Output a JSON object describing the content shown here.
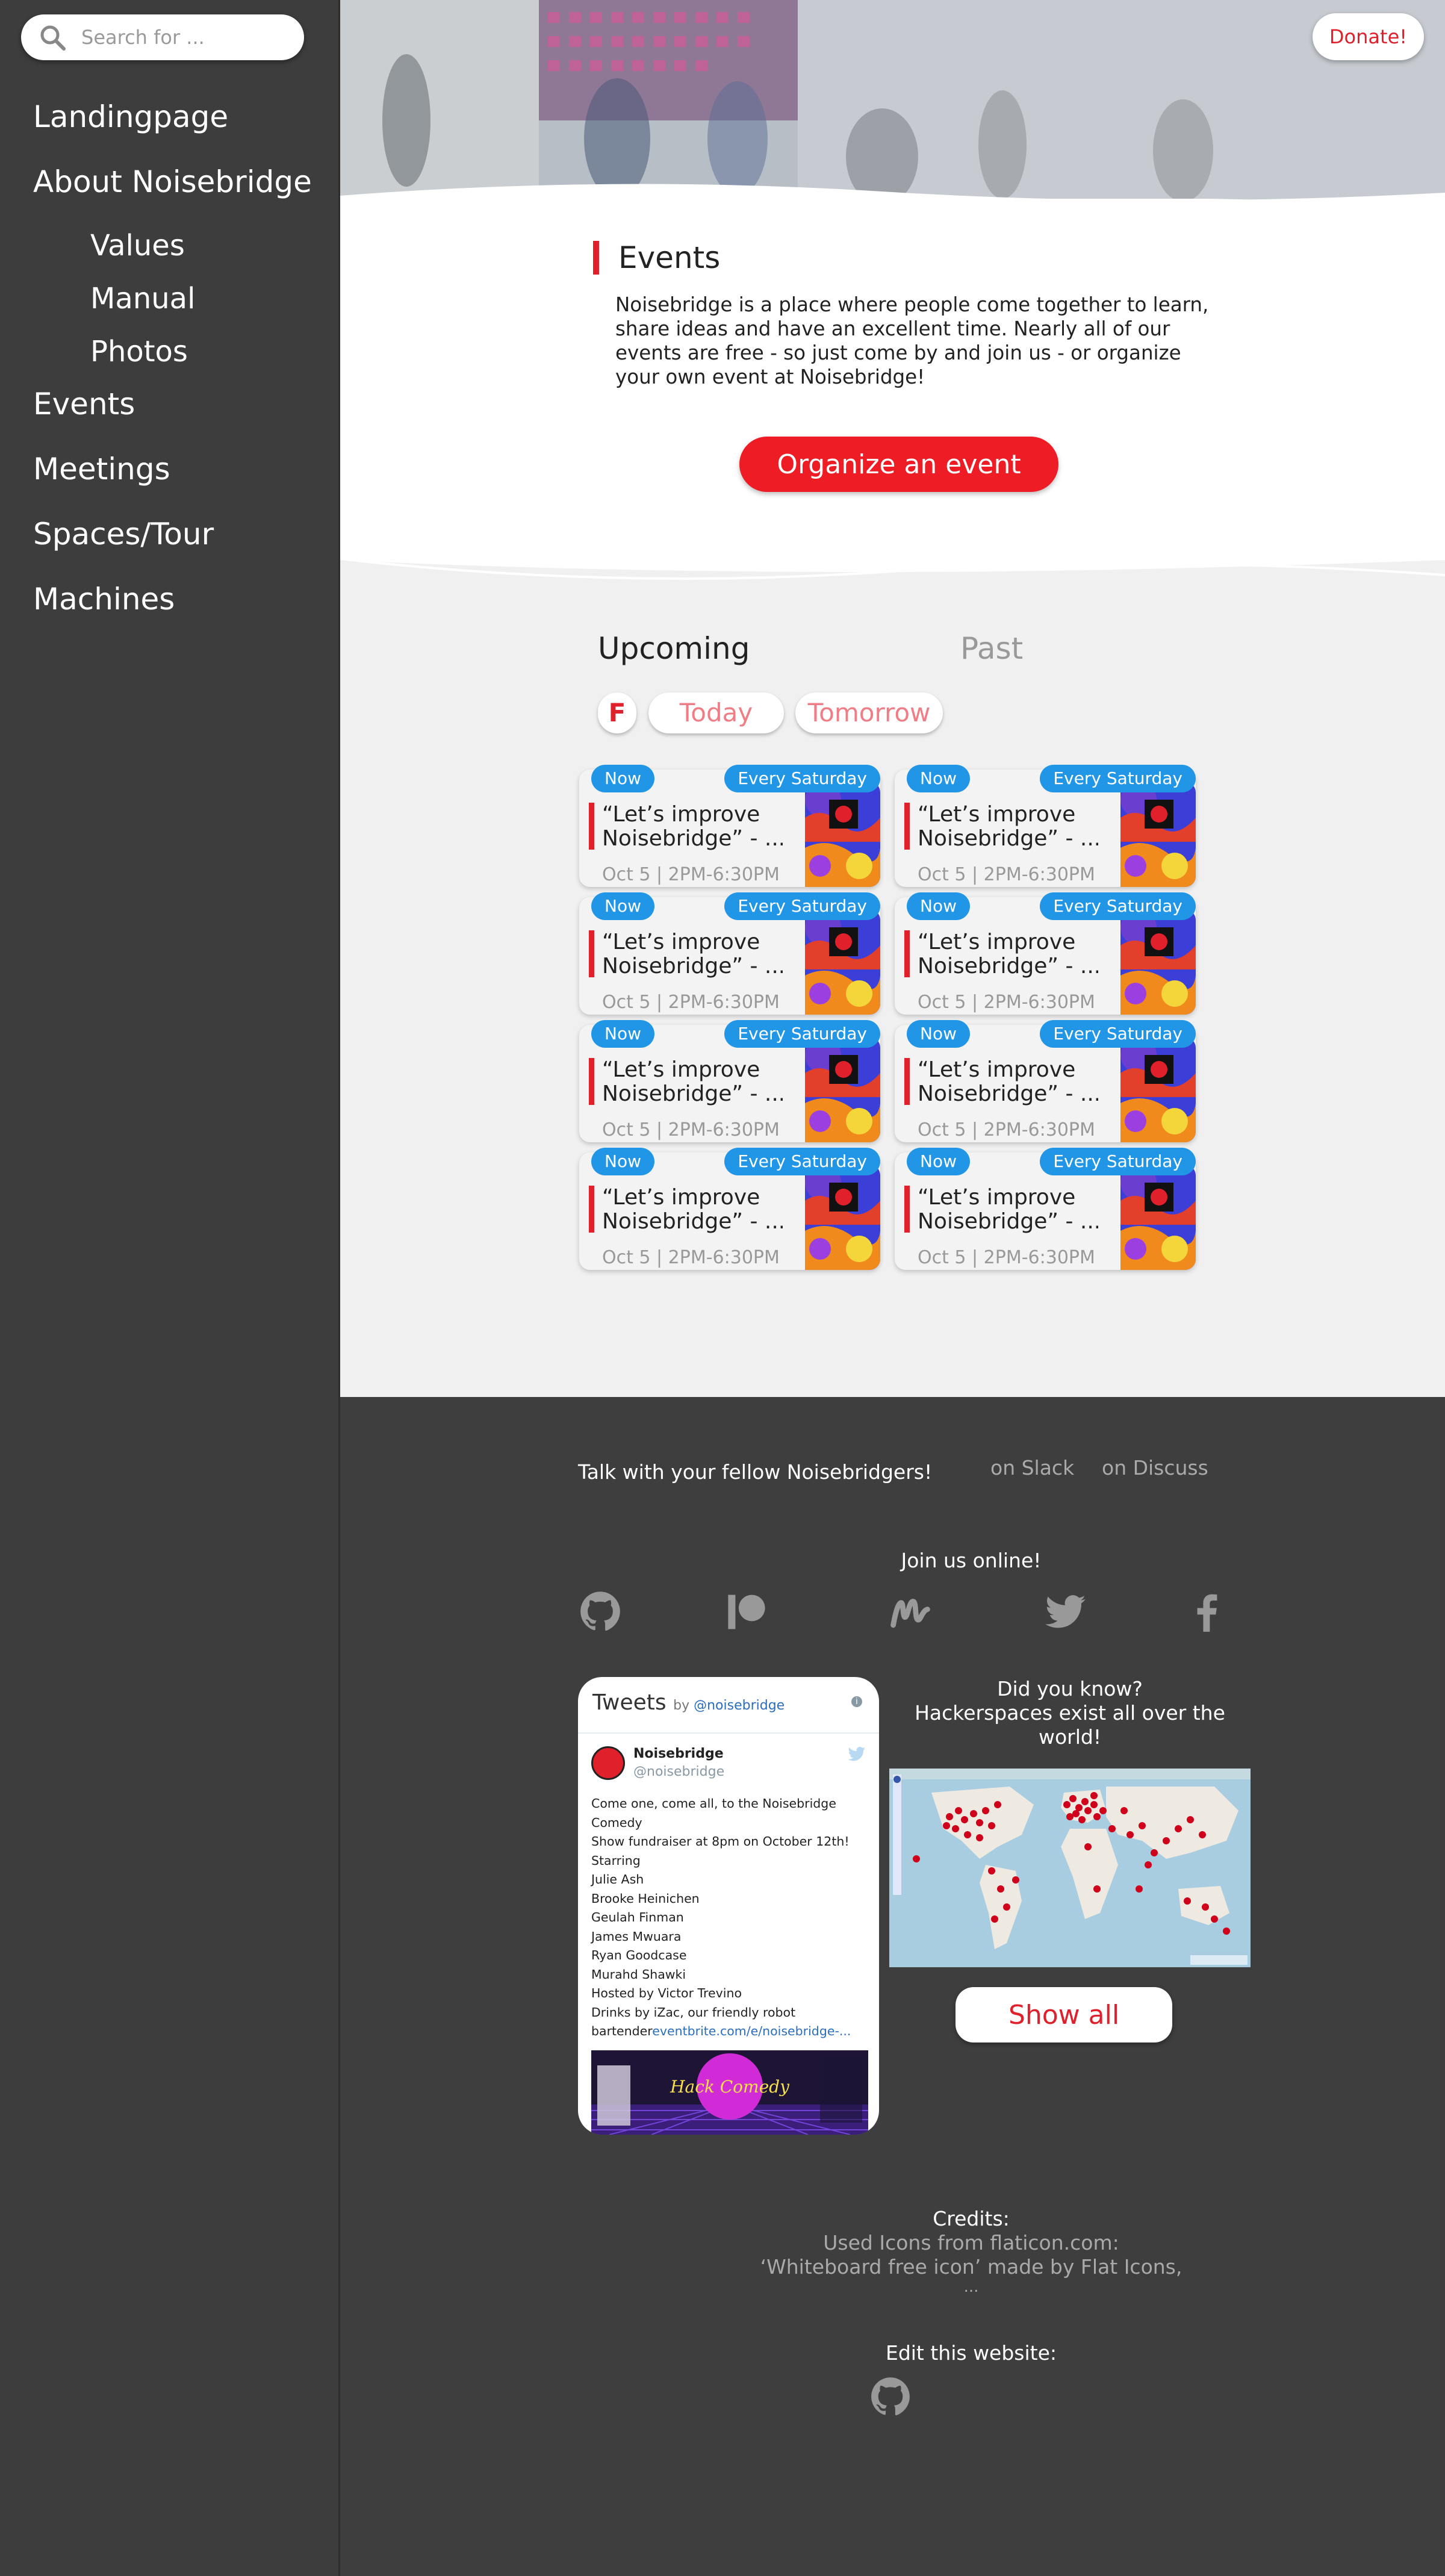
{
  "search": {
    "placeholder": "Search for ..."
  },
  "nav": {
    "landing": "Landingpage",
    "about": "About Noisebridge",
    "values": "Values",
    "manual": "Manual",
    "photos": "Photos",
    "events": "Events",
    "meetings": "Meetings",
    "spaces": "Spaces/Tour",
    "machines": "Machines"
  },
  "header": {
    "donate": "Donate!"
  },
  "events_section": {
    "title": "Events",
    "description": "Noisebridge is a place where people come together to learn, share ideas and have an excellent time. Nearly all of our events are free - so just come by and join us - or organize your own event at Noisebridge!",
    "organize": "Organize an event"
  },
  "tabs": {
    "upcoming": "Upcoming",
    "past": "Past"
  },
  "filters": {
    "f": "F",
    "today": "Today",
    "tomorrow": "Tomorrow"
  },
  "cards": [
    {
      "now": "Now",
      "recurring": "Every Saturday",
      "title_1": "“Let’s improve",
      "title_2": "Noisebridge” - ...",
      "time": "Oct 5 | 2PM-6:30PM"
    },
    {
      "now": "Now",
      "recurring": "Every Saturday",
      "title_1": "“Let’s improve",
      "title_2": "Noisebridge” - ...",
      "time": "Oct 5 | 2PM-6:30PM"
    },
    {
      "now": "Now",
      "recurring": "Every Saturday",
      "title_1": "“Let’s improve",
      "title_2": "Noisebridge” - ...",
      "time": "Oct 5 | 2PM-6:30PM"
    },
    {
      "now": "Now",
      "recurring": "Every Saturday",
      "title_1": "“Let’s improve",
      "title_2": "Noisebridge” - ...",
      "time": "Oct 5 | 2PM-6:30PM"
    },
    {
      "now": "Now",
      "recurring": "Every Saturday",
      "title_1": "“Let’s improve",
      "title_2": "Noisebridge” - ...",
      "time": "Oct 5 | 2PM-6:30PM"
    },
    {
      "now": "Now",
      "recurring": "Every Saturday",
      "title_1": "“Let’s improve",
      "title_2": "Noisebridge” - ...",
      "time": "Oct 5 | 2PM-6:30PM"
    },
    {
      "now": "Now",
      "recurring": "Every Saturday",
      "title_1": "“Let’s improve",
      "title_2": "Noisebridge” - ...",
      "time": "Oct 5 | 2PM-6:30PM"
    },
    {
      "now": "Now",
      "recurring": "Every Saturday",
      "title_1": "“Let’s improve",
      "title_2": "Noisebridge” - ...",
      "time": "Oct 5 | 2PM-6:30PM"
    }
  ],
  "footer": {
    "talk": "Talk with your fellow Noisebridgers!",
    "slack": "on Slack",
    "discuss": "on Discuss",
    "join": "Join us online!",
    "tweets": {
      "title": "Tweets",
      "by": "by",
      "handle_link": "@noisebridge",
      "name": "Noisebridge",
      "handle": "@noisebridge",
      "lines": [
        "Come one, come all, to the Noisebridge Comedy",
        "Show fundraiser at 8pm on October 12th!",
        "Starring",
        "Julie Ash",
        "Brooke Heinichen",
        "Geulah Finman",
        "James Mwuara",
        "Ryan Goodcase",
        "Murahd Shawki",
        "Hosted by Victor Trevino",
        "Drinks by iZac, our friendly robot",
        "bartender"
      ],
      "link": "eventbrite.com/e/noisebridge-...",
      "banner_text": "Hack Comedy"
    },
    "did_you_know_1": "Did you know?",
    "did_you_know_2": "Hackerspaces exist all over the",
    "did_you_know_3": "world!",
    "show_all": "Show all",
    "credits_title": "Credits:",
    "credits_1": "Used Icons from flaticon.com:",
    "credits_2": "‘Whiteboard free icon’ made by Flat Icons,",
    "credits_3": "...",
    "edit": "Edit this website:"
  },
  "colors": {
    "accent": "#ee1c25",
    "badge": "#2196e6",
    "sidebar": "#3d3d3d",
    "footer": "#3e3e3e"
  },
  "icons": [
    "search-icon",
    "github-icon",
    "patreon-icon",
    "meetup-icon",
    "twitter-icon",
    "facebook-icon",
    "info-icon"
  ]
}
